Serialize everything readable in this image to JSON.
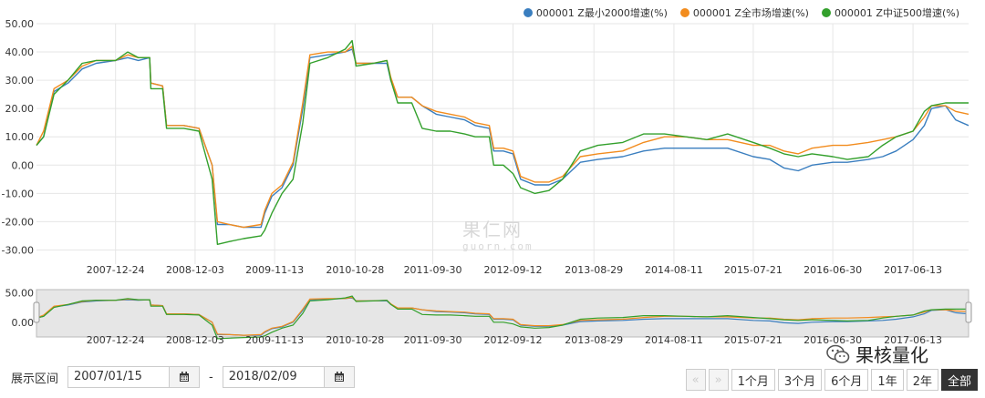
{
  "legend": [
    {
      "label": "000001 Z最小2000增速(%)",
      "color": "#3a7ebf"
    },
    {
      "label": "000001 Z全市场增速(%)",
      "color": "#f28c1e"
    },
    {
      "label": "000001 Z中证500增速(%)",
      "color": "#33a02c"
    }
  ],
  "watermark": {
    "cn": "果仁网",
    "en": "guorn.com"
  },
  "controls": {
    "range_label": "展示区间",
    "start_date": "2007/01/15",
    "end_date": "2018/02/09",
    "dash": "-",
    "calendar_icon": "calendar-icon",
    "prev_icon": "double-left-arrow-icon",
    "next_icon": "double-right-arrow-icon",
    "periods": [
      "1个月",
      "3个月",
      "6个月",
      "1年",
      "2年",
      "全部"
    ],
    "active_period": "全部"
  },
  "brand": {
    "text": "果核量化",
    "icon": "wechat-icon"
  },
  "chart_data": {
    "type": "line",
    "ylim": [
      -35,
      50
    ],
    "yticks": [
      50,
      40,
      30,
      20,
      10,
      0,
      -10,
      -20,
      -30
    ],
    "ytick_labels": [
      "50.00",
      "40.00",
      "30.00",
      "20.00",
      "10.00",
      "0.00",
      "-10.00",
      "-20.00",
      "-30.00"
    ],
    "xlim": [
      "2007-01-15",
      "2018-02-09"
    ],
    "xticks": [
      "2007-12-24",
      "2008-12-03",
      "2009-11-13",
      "2010-10-28",
      "2011-09-30",
      "2012-09-12",
      "2013-08-29",
      "2014-08-11",
      "2015-07-21",
      "2016-06-30",
      "2017-06-13"
    ],
    "navigator": {
      "yticks": [
        50,
        0
      ],
      "ytick_labels": [
        "50.00",
        "0.00"
      ],
      "ylim": [
        -25,
        55
      ]
    },
    "series": [
      {
        "name": "000001 Z最小2000增速(%)",
        "color": "#3a7ebf",
        "points": [
          [
            "2007-01-15",
            7
          ],
          [
            "2007-02-15",
            10
          ],
          [
            "2007-04-01",
            26
          ],
          [
            "2007-06-01",
            29
          ],
          [
            "2007-08-01",
            34
          ],
          [
            "2007-10-01",
            36
          ],
          [
            "2007-12-24",
            37
          ],
          [
            "2008-02-15",
            38
          ],
          [
            "2008-04-01",
            37
          ],
          [
            "2008-05-20",
            38
          ],
          [
            "2008-05-25",
            29
          ],
          [
            "2008-07-15",
            28
          ],
          [
            "2008-08-01",
            14
          ],
          [
            "2008-10-15",
            14
          ],
          [
            "2008-12-20",
            13
          ],
          [
            "2009-02-15",
            0
          ],
          [
            "2009-03-10",
            -21
          ],
          [
            "2009-05-01",
            -21
          ],
          [
            "2009-07-01",
            -22
          ],
          [
            "2009-09-15",
            -22
          ],
          [
            "2009-10-01",
            -17
          ],
          [
            "2009-11-01",
            -11
          ],
          [
            "2009-12-15",
            -8
          ],
          [
            "2010-02-01",
            0
          ],
          [
            "2010-03-15",
            20
          ],
          [
            "2010-04-15",
            38
          ],
          [
            "2010-07-01",
            39
          ],
          [
            "2010-09-15",
            40
          ],
          [
            "2010-10-15",
            41
          ],
          [
            "2010-11-01",
            36
          ],
          [
            "2011-01-15",
            36
          ],
          [
            "2011-03-15",
            36
          ],
          [
            "2011-04-01",
            30
          ],
          [
            "2011-05-01",
            24
          ],
          [
            "2011-07-01",
            24
          ],
          [
            "2011-08-15",
            21
          ],
          [
            "2011-10-15",
            18
          ],
          [
            "2011-12-15",
            17
          ],
          [
            "2012-02-15",
            16
          ],
          [
            "2012-04-01",
            14
          ],
          [
            "2012-06-01",
            13
          ],
          [
            "2012-06-20",
            5
          ],
          [
            "2012-08-01",
            5
          ],
          [
            "2012-09-12",
            4
          ],
          [
            "2012-10-15",
            -5
          ],
          [
            "2012-12-15",
            -7
          ],
          [
            "2013-02-15",
            -7
          ],
          [
            "2013-04-15",
            -5
          ],
          [
            "2013-07-01",
            1
          ],
          [
            "2013-09-15",
            2
          ],
          [
            "2014-01-01",
            3
          ],
          [
            "2014-04-01",
            5
          ],
          [
            "2014-07-01",
            6
          ],
          [
            "2014-10-01",
            6
          ],
          [
            "2015-01-01",
            6
          ],
          [
            "2015-04-01",
            6
          ],
          [
            "2015-07-21",
            3
          ],
          [
            "2015-10-01",
            2
          ],
          [
            "2015-12-01",
            -1
          ],
          [
            "2016-02-01",
            -2
          ],
          [
            "2016-04-01",
            0
          ],
          [
            "2016-06-30",
            1
          ],
          [
            "2016-09-01",
            1
          ],
          [
            "2016-12-01",
            2
          ],
          [
            "2017-02-01",
            3
          ],
          [
            "2017-04-01",
            5
          ],
          [
            "2017-06-13",
            9
          ],
          [
            "2017-08-01",
            14
          ],
          [
            "2017-09-01",
            20
          ],
          [
            "2017-11-01",
            21
          ],
          [
            "2017-12-15",
            16
          ],
          [
            "2018-02-09",
            14
          ]
        ]
      },
      {
        "name": "000001 Z全市场增速(%)",
        "color": "#f28c1e",
        "points": [
          [
            "2007-01-15",
            7
          ],
          [
            "2007-02-15",
            12
          ],
          [
            "2007-04-01",
            27
          ],
          [
            "2007-06-01",
            30
          ],
          [
            "2007-08-01",
            35
          ],
          [
            "2007-10-01",
            37
          ],
          [
            "2007-12-24",
            37
          ],
          [
            "2008-02-15",
            39
          ],
          [
            "2008-04-01",
            38
          ],
          [
            "2008-05-20",
            38
          ],
          [
            "2008-05-25",
            29
          ],
          [
            "2008-07-15",
            28
          ],
          [
            "2008-08-01",
            14
          ],
          [
            "2008-10-15",
            14
          ],
          [
            "2008-12-20",
            13
          ],
          [
            "2009-02-15",
            0
          ],
          [
            "2009-03-10",
            -20
          ],
          [
            "2009-05-01",
            -21
          ],
          [
            "2009-07-01",
            -22
          ],
          [
            "2009-09-15",
            -21
          ],
          [
            "2009-10-01",
            -16
          ],
          [
            "2009-11-01",
            -10
          ],
          [
            "2009-12-15",
            -7
          ],
          [
            "2010-02-01",
            1
          ],
          [
            "2010-03-15",
            22
          ],
          [
            "2010-04-15",
            39
          ],
          [
            "2010-07-01",
            40
          ],
          [
            "2010-09-15",
            40
          ],
          [
            "2010-10-15",
            42
          ],
          [
            "2010-11-01",
            36
          ],
          [
            "2011-01-15",
            36
          ],
          [
            "2011-03-15",
            37
          ],
          [
            "2011-04-01",
            31
          ],
          [
            "2011-05-01",
            24
          ],
          [
            "2011-07-01",
            24
          ],
          [
            "2011-08-15",
            21
          ],
          [
            "2011-10-15",
            19
          ],
          [
            "2011-12-15",
            18
          ],
          [
            "2012-02-15",
            17
          ],
          [
            "2012-04-01",
            15
          ],
          [
            "2012-06-01",
            14
          ],
          [
            "2012-06-20",
            6
          ],
          [
            "2012-08-01",
            6
          ],
          [
            "2012-09-12",
            5
          ],
          [
            "2012-10-15",
            -4
          ],
          [
            "2012-12-15",
            -6
          ],
          [
            "2013-02-15",
            -6
          ],
          [
            "2013-04-15",
            -4
          ],
          [
            "2013-07-01",
            3
          ],
          [
            "2013-09-15",
            4
          ],
          [
            "2014-01-01",
            5
          ],
          [
            "2014-04-01",
            8
          ],
          [
            "2014-07-01",
            10
          ],
          [
            "2014-10-01",
            10
          ],
          [
            "2015-01-01",
            9
          ],
          [
            "2015-04-01",
            9
          ],
          [
            "2015-07-21",
            7
          ],
          [
            "2015-10-01",
            7
          ],
          [
            "2015-12-01",
            5
          ],
          [
            "2016-02-01",
            4
          ],
          [
            "2016-04-01",
            6
          ],
          [
            "2016-06-30",
            7
          ],
          [
            "2016-09-01",
            7
          ],
          [
            "2016-12-01",
            8
          ],
          [
            "2017-02-01",
            9
          ],
          [
            "2017-04-01",
            10
          ],
          [
            "2017-06-13",
            12
          ],
          [
            "2017-08-01",
            17
          ],
          [
            "2017-09-01",
            21
          ],
          [
            "2017-11-01",
            21
          ],
          [
            "2017-12-15",
            19
          ],
          [
            "2018-02-09",
            18
          ]
        ]
      },
      {
        "name": "000001 Z中证500增速(%)",
        "color": "#33a02c",
        "points": [
          [
            "2007-01-15",
            7
          ],
          [
            "2007-02-15",
            10
          ],
          [
            "2007-04-01",
            25
          ],
          [
            "2007-06-01",
            30
          ],
          [
            "2007-08-01",
            36
          ],
          [
            "2007-10-01",
            37
          ],
          [
            "2007-12-24",
            37
          ],
          [
            "2008-02-15",
            40
          ],
          [
            "2008-04-01",
            38
          ],
          [
            "2008-05-20",
            38
          ],
          [
            "2008-05-25",
            27
          ],
          [
            "2008-07-15",
            27
          ],
          [
            "2008-08-01",
            13
          ],
          [
            "2008-10-15",
            13
          ],
          [
            "2008-12-20",
            12
          ],
          [
            "2009-02-15",
            -5
          ],
          [
            "2009-03-10",
            -28
          ],
          [
            "2009-05-01",
            -27
          ],
          [
            "2009-07-01",
            -26
          ],
          [
            "2009-09-15",
            -25
          ],
          [
            "2009-10-01",
            -23
          ],
          [
            "2009-11-01",
            -17
          ],
          [
            "2009-12-15",
            -10
          ],
          [
            "2010-02-01",
            -5
          ],
          [
            "2010-03-15",
            15
          ],
          [
            "2010-04-15",
            36
          ],
          [
            "2010-07-01",
            38
          ],
          [
            "2010-09-15",
            41
          ],
          [
            "2010-10-15",
            44
          ],
          [
            "2010-11-01",
            35
          ],
          [
            "2011-01-15",
            36
          ],
          [
            "2011-03-15",
            37
          ],
          [
            "2011-04-01",
            30
          ],
          [
            "2011-05-01",
            22
          ],
          [
            "2011-07-01",
            22
          ],
          [
            "2011-08-15",
            13
          ],
          [
            "2011-10-15",
            12
          ],
          [
            "2011-12-15",
            12
          ],
          [
            "2012-02-15",
            11
          ],
          [
            "2012-04-01",
            10
          ],
          [
            "2012-06-01",
            10
          ],
          [
            "2012-06-20",
            0
          ],
          [
            "2012-08-01",
            0
          ],
          [
            "2012-09-12",
            -3
          ],
          [
            "2012-10-15",
            -8
          ],
          [
            "2012-12-15",
            -10
          ],
          [
            "2013-02-15",
            -9
          ],
          [
            "2013-04-15",
            -5
          ],
          [
            "2013-07-01",
            5
          ],
          [
            "2013-09-15",
            7
          ],
          [
            "2014-01-01",
            8
          ],
          [
            "2014-04-01",
            11
          ],
          [
            "2014-07-01",
            11
          ],
          [
            "2014-10-01",
            10
          ],
          [
            "2015-01-01",
            9
          ],
          [
            "2015-04-01",
            11
          ],
          [
            "2015-07-21",
            8
          ],
          [
            "2015-10-01",
            6
          ],
          [
            "2015-12-01",
            4
          ],
          [
            "2016-02-01",
            3
          ],
          [
            "2016-04-01",
            4
          ],
          [
            "2016-06-30",
            3
          ],
          [
            "2016-09-01",
            2
          ],
          [
            "2016-12-01",
            3
          ],
          [
            "2017-02-01",
            7
          ],
          [
            "2017-04-01",
            10
          ],
          [
            "2017-06-13",
            12
          ],
          [
            "2017-08-01",
            19
          ],
          [
            "2017-09-01",
            21
          ],
          [
            "2017-11-01",
            22
          ],
          [
            "2017-12-15",
            22
          ],
          [
            "2018-02-09",
            22
          ]
        ]
      }
    ]
  }
}
